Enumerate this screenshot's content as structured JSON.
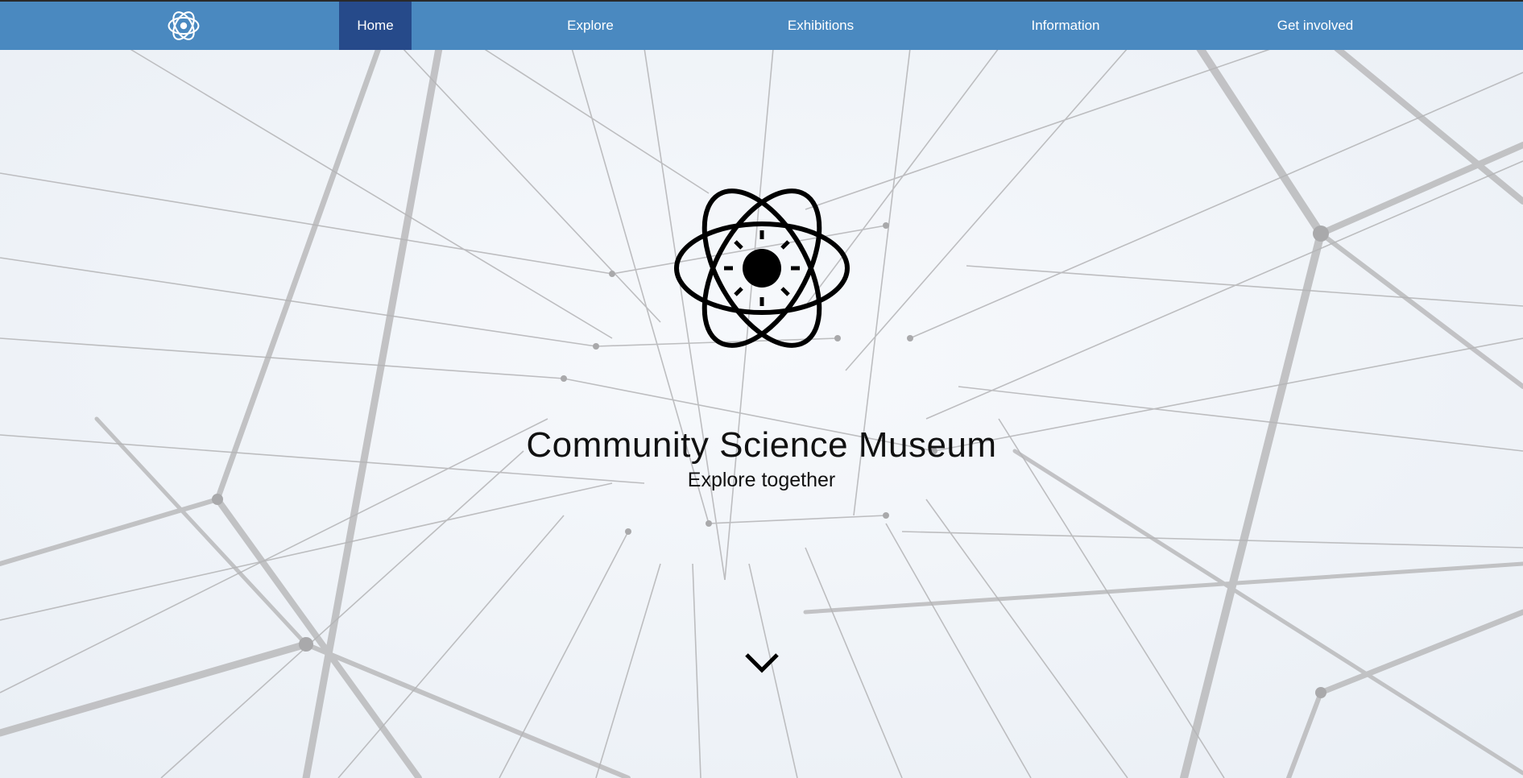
{
  "nav": {
    "logo_icon": "atom-sun-icon",
    "items": [
      {
        "label": "Home",
        "active": true
      },
      {
        "label": "Explore",
        "active": false
      },
      {
        "label": "Exhibitions",
        "active": false
      },
      {
        "label": "Information",
        "active": false
      },
      {
        "label": "Get involved",
        "active": false
      }
    ]
  },
  "hero": {
    "logo_icon": "atom-sun-icon",
    "title": "Community Science Museum",
    "subtitle": "Explore together",
    "scroll_icon": "chevron-down-icon"
  },
  "colors": {
    "nav_background": "#4a89c0",
    "nav_active": "#264a8a",
    "hero_background": "#f2f5f9",
    "network_lines": "#b8b8ba",
    "text": "#111111"
  }
}
